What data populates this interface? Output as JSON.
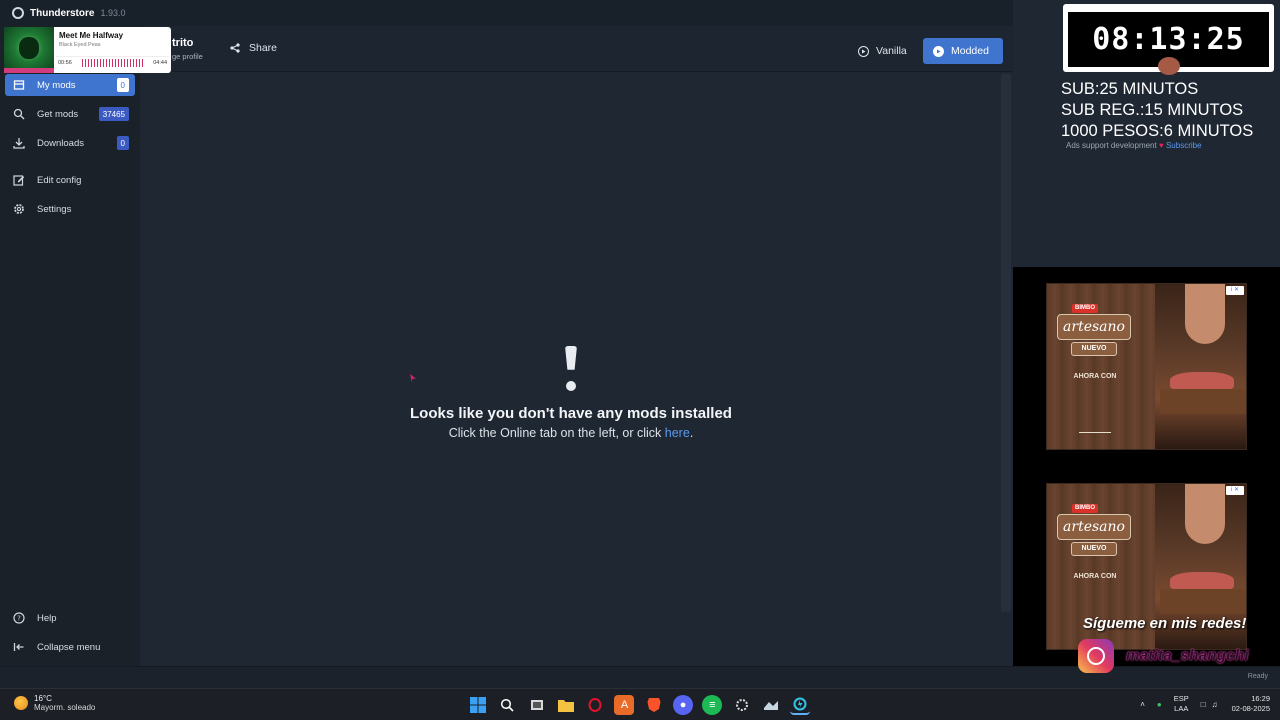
{
  "titlebar": {
    "app_name": "Thunderstore",
    "version": "1.93.0"
  },
  "header": {
    "profile_name": "trito",
    "profile_sub": "ge profile",
    "share_label": "Share",
    "vanilla_label": "Vanilla",
    "modded_label": "Modded"
  },
  "sidebar": {
    "items": [
      {
        "label": "My mods",
        "badge": "0",
        "icon": "box-icon"
      },
      {
        "label": "Get mods",
        "badge": "37465",
        "icon": "search-icon"
      },
      {
        "label": "Downloads",
        "badge": "0",
        "icon": "download-icon"
      },
      {
        "label": "Edit config",
        "icon": "edit-icon"
      },
      {
        "label": "Settings",
        "icon": "gear-icon"
      }
    ],
    "bottom": [
      {
        "label": "Help",
        "icon": "help-icon"
      },
      {
        "label": "Collapse menu",
        "icon": "collapse-icon"
      }
    ]
  },
  "empty_state": {
    "title": "Looks like you don't have any mods installed",
    "sub_prefix": "Click the Online tab on the left, or click ",
    "link": "here",
    "sub_suffix": "."
  },
  "status": {
    "ready": "Ready"
  },
  "music": {
    "track": "Meet Me Halfway",
    "artist": "Black Eyed Peas",
    "elapsed": "00:56",
    "duration": "04:44"
  },
  "overlay": {
    "timer": "08:13:25",
    "lines": [
      "SUB:25 MINUTOS",
      "SUB REG.:15 MINUTOS",
      "1000 PESOS:6 MINUTOS"
    ],
    "ads_text": "Ads support development",
    "subscribe": "Subscribe",
    "ad": {
      "brand": "BIMBO",
      "name": "artesano",
      "nuevo": "NUEVO",
      "ahora": "AHORA CON"
    },
    "social": "Sígueme en mis redes!",
    "handle": "matita_shangchi"
  },
  "taskbar": {
    "weather_temp": "16°C",
    "weather_desc": "Mayorm. soleado",
    "lang_top": "ESP",
    "lang_bottom": "LAA",
    "time": "16:29",
    "date": "02-08-2025"
  },
  "colors": {
    "accent": "#3f74cf",
    "background": "#1f2732",
    "sidebar": "#1a2129",
    "link": "#5b9bf0"
  }
}
